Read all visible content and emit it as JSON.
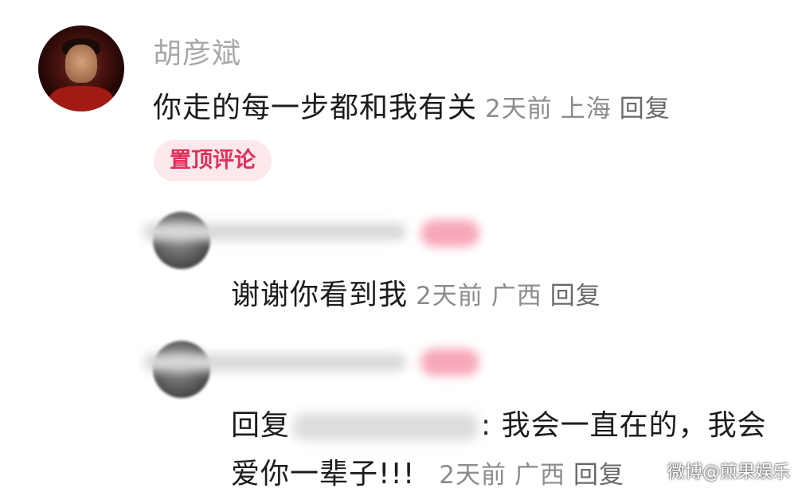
{
  "main_comment": {
    "author": "胡彦斌",
    "text": "你走的每一步都和我有关",
    "time": "2天前",
    "location": "上海",
    "reply_label": "回复",
    "pinned_badge": "置顶评论"
  },
  "replies": [
    {
      "text": "谢谢你看到我",
      "time": "2天前",
      "location": "广西",
      "reply_label": "回复"
    },
    {
      "reply_prefix": "回复",
      "text_line1": ": 我会一直在的，我会",
      "text_line2": "爱你一辈子!!!",
      "time": "2天前",
      "location": "广西",
      "reply_label": "回复"
    }
  ],
  "watermark": "微博@煎果娱乐"
}
